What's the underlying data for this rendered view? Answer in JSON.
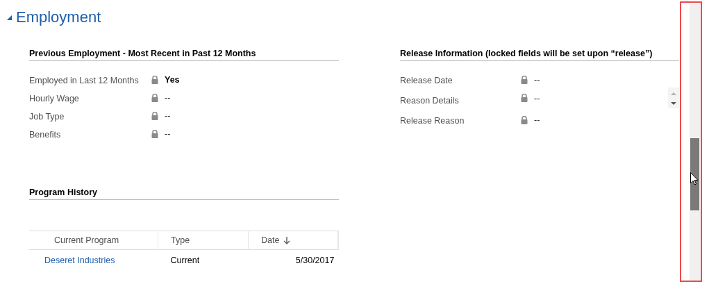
{
  "section": {
    "title": "Employment",
    "expanded": true
  },
  "previous_employment": {
    "heading": "Previous Employment - Most Recent in Past 12 Months",
    "fields": [
      {
        "label": "Employed in Last 12 Months",
        "value": "Yes",
        "locked": true
      },
      {
        "label": "Hourly Wage",
        "value": "--",
        "locked": true
      },
      {
        "label": "Job Type",
        "value": "--",
        "locked": true
      },
      {
        "label": "Benefits",
        "value": "--",
        "locked": true
      }
    ]
  },
  "release_information": {
    "heading": "Release Information (locked fields will be set upon “release”)",
    "fields": [
      {
        "label": "Release Date",
        "value": "--",
        "locked": true
      },
      {
        "label": "Reason Details",
        "value": "--",
        "locked": true,
        "kind": "multiline"
      },
      {
        "label": "Release Reason",
        "value": "--",
        "locked": true
      }
    ]
  },
  "program_history": {
    "heading": "Program History",
    "columns": [
      {
        "label": "Current Program",
        "sorted": false
      },
      {
        "label": "Type",
        "sorted": false
      },
      {
        "label": "Date",
        "sorted": true
      }
    ],
    "rows": [
      {
        "program": "Deseret Industries",
        "type": "Current",
        "date": "5/30/2017"
      }
    ]
  }
}
